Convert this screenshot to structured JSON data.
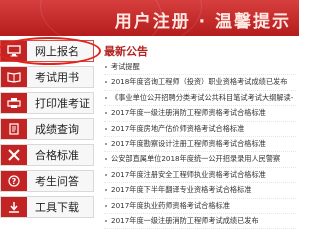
{
  "banner": {
    "title": "用户注册 · 温馨提示"
  },
  "sidebar": {
    "items": [
      {
        "label": "网上报名",
        "icon": "monitor-icon",
        "active": true
      },
      {
        "label": "考试用书",
        "icon": "book-icon",
        "active": false
      },
      {
        "label": "打印准考证",
        "icon": "printer-icon",
        "active": false
      },
      {
        "label": "成绩查询",
        "icon": "document-icon",
        "active": false
      },
      {
        "label": "合格标准",
        "icon": "tools-icon",
        "active": false
      },
      {
        "label": "考生问答",
        "icon": "question-icon",
        "active": false
      },
      {
        "label": "工具下载",
        "icon": "download-icon",
        "active": false
      }
    ]
  },
  "main": {
    "section_title": "最新公告",
    "news": [
      "考试提醒",
      "2018年度咨询工程师（投资）职业资格考试成绩已发布",
      "《事业单位公开招聘分类考试公共科目笔试考试大纲解读-",
      "2017年度一级注册消防工程师资格考试合格标准",
      "2017年度房地产估价师资格考试合格标准",
      "2017年度勘察设计注册工程师资格考试合格标准",
      "公安部直属单位2018年度统一公开招录录用人民警察",
      "2017年度注册安全工程师执业资格考试合格标准",
      "2017年度下半年翻译专业资格考试合格标准",
      "2017年度执业药师资格考试合格标准",
      "2017年度一级注册消防工程师考试成绩已发布"
    ]
  },
  "colors": {
    "brand_red": "#c22424",
    "highlight_circle": "#e2231a",
    "section_title": "#b2231f"
  }
}
